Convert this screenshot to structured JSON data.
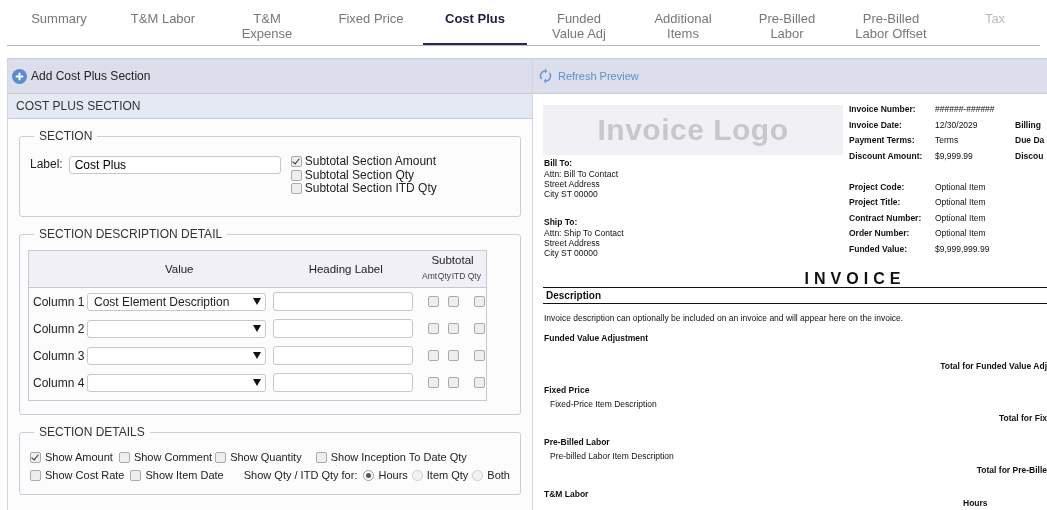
{
  "tabs": [
    {
      "label": "Summary",
      "selected": false,
      "disabled": false
    },
    {
      "label": "T&M Labor",
      "selected": false,
      "disabled": false
    },
    {
      "label": "T&M Expense",
      "selected": false,
      "disabled": false
    },
    {
      "label": "Fixed Price",
      "selected": false,
      "disabled": false
    },
    {
      "label": "Cost Plus",
      "selected": true,
      "disabled": false
    },
    {
      "label": "Funded Value Adj",
      "selected": false,
      "disabled": false
    },
    {
      "label": "Additional Items",
      "selected": false,
      "disabled": false
    },
    {
      "label": "Pre-Billed Labor",
      "selected": false,
      "disabled": false
    },
    {
      "label": "Pre-Billed Labor Offset",
      "selected": false,
      "disabled": false
    },
    {
      "label": "Tax",
      "selected": false,
      "disabled": true
    }
  ],
  "editor": {
    "add_button": "Add Cost Plus Section",
    "section_title": "COST PLUS SECTION",
    "section": {
      "legend": "SECTION",
      "label": "Label:",
      "value": "Cost Plus",
      "options": [
        {
          "label": "Subtotal Section Amount",
          "checked": true
        },
        {
          "label": "Subtotal Section Qty",
          "checked": false
        },
        {
          "label": "Subtotal Section ITD Qty",
          "checked": false
        }
      ]
    },
    "description_detail": {
      "legend": "SECTION DESCRIPTION DETAIL",
      "headers": {
        "value": "Value",
        "heading_label": "Heading Label",
        "subtotal": "Subtotal",
        "subtotal_columns": [
          "Amt",
          "Qty",
          "ITD Qty"
        ]
      },
      "rows": [
        {
          "label": "Column 1",
          "value": "Cost Element Description",
          "subtotals": [
            false,
            false,
            false
          ]
        },
        {
          "label": "Column 2",
          "subtotals": [
            false,
            false,
            false
          ]
        },
        {
          "label": "Column 3",
          "subtotals": [
            false,
            false,
            false
          ]
        },
        {
          "label": "Column 4",
          "subtotals": [
            false,
            false,
            false
          ]
        }
      ]
    },
    "section_details": {
      "legend": "SECTION DETAILS",
      "row_1": [
        {
          "label": "Show Amount",
          "checked": true
        },
        {
          "label": "Show Comment",
          "checked": false
        },
        {
          "label": "Show Quantity",
          "checked": false
        },
        {
          "label": "Show Inception To Date Qty",
          "checked": false
        }
      ],
      "row_2": [
        {
          "label": "Show Cost Rate",
          "checked": false
        },
        {
          "label": "Show Item Date",
          "checked": false
        }
      ],
      "qty_for_label": "Show Qty / ITD Qty for:",
      "qty_for": [
        {
          "label": "Hours",
          "selected": true
        },
        {
          "label": "Item Qty",
          "selected": false
        },
        {
          "label": "Both",
          "selected": false
        }
      ]
    }
  },
  "preview": {
    "refresh_button": "Refresh Preview",
    "logo": "Invoice Logo",
    "bill_to": {
      "title": "Bill To:",
      "lines": [
        "Attn: Bill To Contact",
        "Street Address",
        "City ST 00000"
      ]
    },
    "ship_to": {
      "title": "Ship To:",
      "lines": [
        "Attn: Ship To Contact",
        "Street Address",
        "City ST 00000"
      ]
    },
    "invoice_info": [
      {
        "label": "Invoice Number:",
        "value": "######-######"
      },
      {
        "label": "Invoice Date:",
        "value": "12/30/2029",
        "extra": "Billing"
      },
      {
        "label": "Payment Terms:",
        "value": "Terms",
        "extra": "Due Da"
      },
      {
        "label": "Discount Amount:",
        "value": "$9,999.99",
        "extra": "Discou"
      }
    ],
    "project_info": [
      {
        "label": "Project Code:",
        "value": "Optional Item"
      },
      {
        "label": "Project Title:",
        "value": "Optional Item"
      },
      {
        "label": "Contract Number:",
        "value": "Optional Item"
      },
      {
        "label": "Order Number:",
        "value": "Optional Item"
      },
      {
        "label": "Funded Value:",
        "value": "$9,999,999.99"
      }
    ],
    "title": "INVOICE",
    "description_heading": "Description",
    "description": "Invoice description can optionally be included on an invoice and will appear here on the invoice.",
    "groups": [
      {
        "title": "Funded Value Adjustment",
        "total": "Total for Funded Value Adj"
      },
      {
        "title": "Fixed Price",
        "item": "Fixed-Price Item Description",
        "total": "Total for Fix"
      },
      {
        "title": "Pre-Billed Labor",
        "item": "Pre-billed Labor Item Description",
        "total": "Total for Pre-Bille"
      },
      {
        "title": "T&M Labor",
        "column_heading": "Hours"
      }
    ]
  }
}
